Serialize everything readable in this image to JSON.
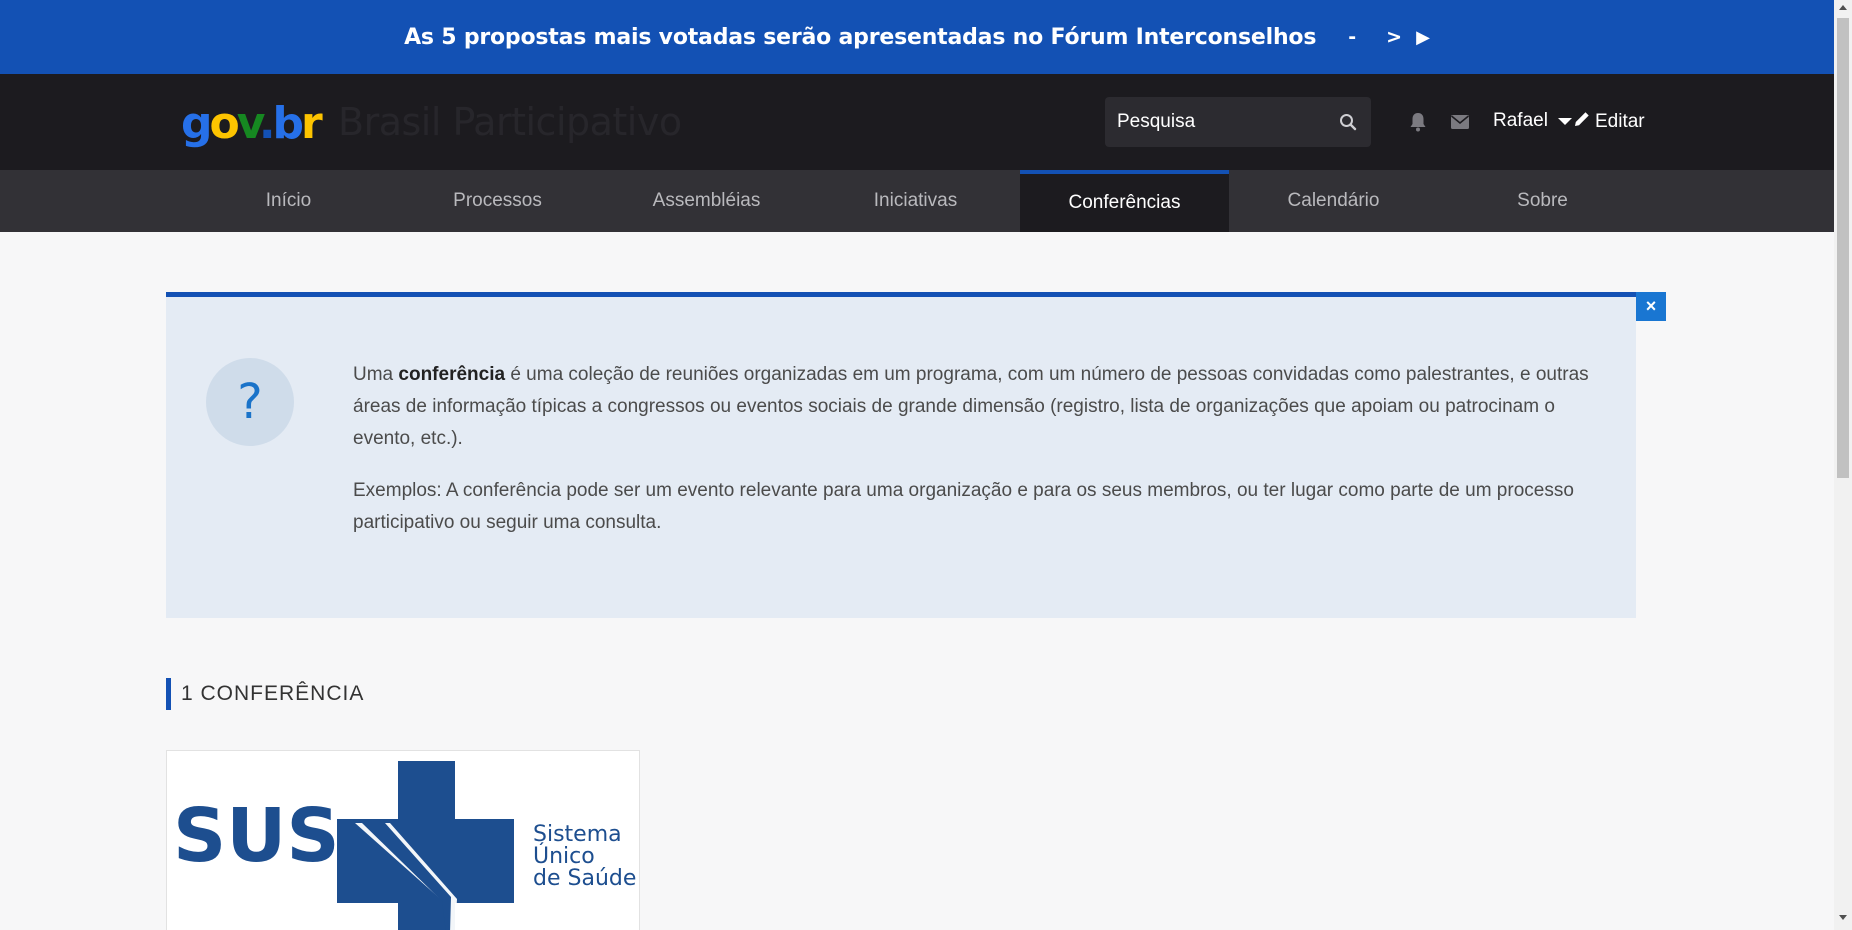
{
  "banner": {
    "text": "As 5 propostas mais votadas serão apresentadas no Fórum Interconselhos",
    "prev": "-",
    "next": ">",
    "play": "▶"
  },
  "header": {
    "logo": {
      "g": "g",
      "o": "o",
      "v": "v",
      "dot": ".",
      "b": "b",
      "r": "r"
    },
    "site_title": "Brasil Participativo",
    "search_placeholder": "Pesquisa",
    "user_name": "Rafael",
    "edit_label": "Editar"
  },
  "nav": {
    "items": [
      "Início",
      "Processos",
      "Assembléias",
      "Iniciativas",
      "Conferências",
      "Calendário",
      "Sobre"
    ],
    "active": "Conferências"
  },
  "help": {
    "close": "×",
    "icon_glyph": "?",
    "p1_pre": "Uma ",
    "p1_bold": "conferência",
    "p1_post": " é uma coleção de reuniões organizadas em um programa, com um número de pessoas convidadas como palestrantes, e outras áreas de informação típicas a congressos ou eventos sociais de grande dimensão (registro, lista de organizações que apoiam ou patrocinam o evento, etc.).",
    "p2": "Exemplos: A conferência pode ser um evento relevante para uma organização e para os seus membros, ou ter lugar como parte de um processo participativo ou seguir uma consulta."
  },
  "listing": {
    "count_heading": "1 CONFERÊNCIA"
  },
  "card": {
    "logo_text": "SUS",
    "logo_caption_1": "Sistema",
    "logo_caption_2": "Único",
    "logo_caption_3": "de Saúde"
  },
  "colors": {
    "brand_blue": "#1351b4",
    "top_dark": "#1c1b1f",
    "nav_dark": "#323136",
    "help_bg": "#e4ebf4",
    "sus_blue": "#1d4e8f"
  }
}
